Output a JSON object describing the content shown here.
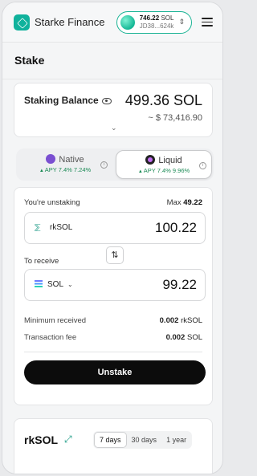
{
  "header": {
    "brand": "Starke Finance",
    "wallet": {
      "balance": "746.22",
      "currency": "SOL",
      "address": "JD38...624k"
    }
  },
  "page": {
    "title": "Stake"
  },
  "balance": {
    "label": "Staking Balance",
    "amount": "499.36 SOL",
    "usd": "~ $ 73,416.90"
  },
  "toggle": {
    "native": {
      "label": "Native",
      "apy": "APY 7.4% 7.24%"
    },
    "liquid": {
      "label": "Liquid",
      "apy": "APY 7.4% 9.96%"
    },
    "selected": "Liquid"
  },
  "swap": {
    "unstaking_label": "You're unstaking",
    "max_label": "Max",
    "max_value": "49.22",
    "from_token": "rkSOL",
    "from_value": "100.22",
    "receive_label": "To receive",
    "to_token": "SOL",
    "to_value": "99.22",
    "min_received_label": "Minimum received",
    "min_received_amount": "0.002",
    "min_received_unit": "rkSOL",
    "fee_label": "Transaction fee",
    "fee_amount": "0.002",
    "fee_unit": "SOL",
    "button": "Unstake"
  },
  "chart_card": {
    "title": "rkSOL",
    "ranges": [
      "7 days",
      "30 days",
      "1 year"
    ],
    "active_range": "7 days"
  },
  "colors": {
    "accent": "#19b394",
    "button": "#0c0c0c",
    "positive": "#1b8a55"
  }
}
